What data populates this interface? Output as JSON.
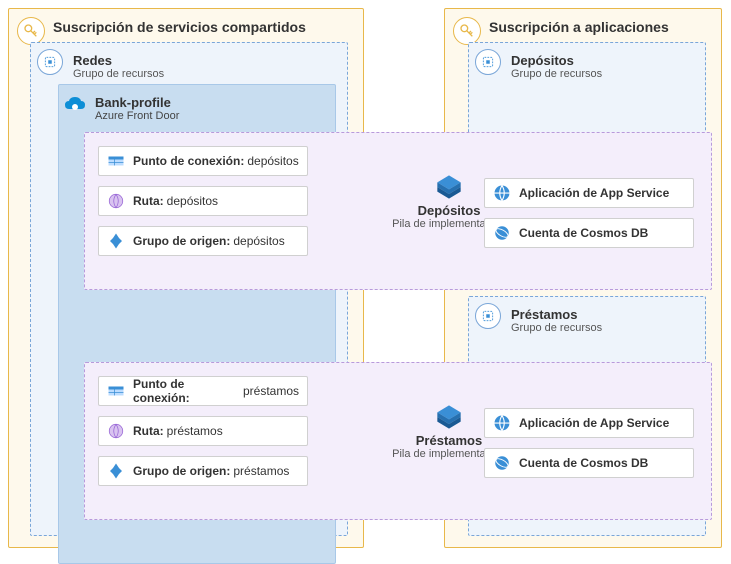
{
  "left_sub_title": "Suscripción de servicios compartidos",
  "right_sub_title": "Suscripción a aplicaciones",
  "rg_redes": {
    "title": "Redes",
    "subtitle": "Grupo de recursos"
  },
  "frontdoor": {
    "title": "Bank-profile",
    "subtitle": "Azure Front Door"
  },
  "rg_dep": {
    "title": "Depósitos",
    "subtitle": "Grupo de recursos"
  },
  "rg_prest": {
    "title": "Préstamos",
    "subtitle": "Grupo de recursos"
  },
  "stack_dep": {
    "label": "Depósitos",
    "sublabel": "Pila de implementación"
  },
  "stack_prest": {
    "label": "Préstamos",
    "sublabel": "Pila de implementación"
  },
  "rows_left_dep": [
    {
      "label": "Punto de conexión:",
      "value": "depósitos"
    },
    {
      "label": "Ruta:",
      "value": "depósitos"
    },
    {
      "label": "Grupo de origen:",
      "value": "depósitos"
    }
  ],
  "rows_left_prest": [
    {
      "label": "Punto de conexión:",
      "value": "préstamos"
    },
    {
      "label": "Ruta:",
      "value": "préstamos"
    },
    {
      "label": "Grupo de origen:",
      "value": "préstamos"
    }
  ],
  "rows_right_dep": [
    {
      "label": "Aplicación de App Service"
    },
    {
      "label": "Cuenta de Cosmos DB"
    }
  ],
  "rows_right_prest": [
    {
      "label": "Aplicación de App Service"
    },
    {
      "label": "Cuenta de Cosmos DB"
    }
  ]
}
